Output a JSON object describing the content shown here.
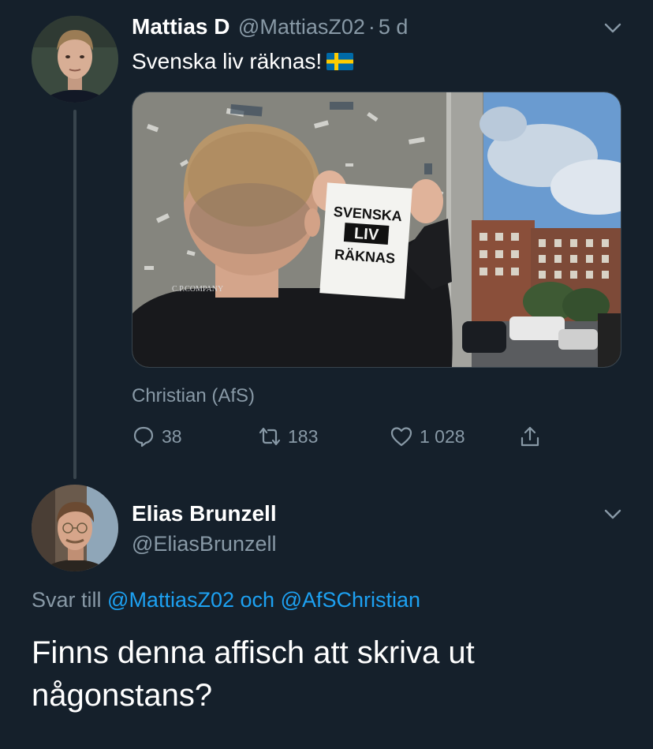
{
  "tweet1": {
    "display_name": "Mattias D",
    "handle": "@MattiasZ02",
    "separator": "·",
    "time": "5 d",
    "text": "Svenska liv räknas!",
    "flag_emoji": "🇸🇪",
    "media_poster_text": [
      "SVENSKA",
      "LIV",
      "RÄKNAS"
    ],
    "media_jacket_text": "C.P.COMPANY",
    "tag": "Christian (AfS)",
    "replies": "38",
    "retweets": "183",
    "likes": "1 028"
  },
  "tweet2": {
    "display_name": "Elias Brunzell",
    "handle": "@EliasBrunzell",
    "reply_prefix": "Svar till",
    "reply_to_1": "@MattiasZ02",
    "reply_join": "och",
    "reply_to_2": "@AfSChristian",
    "text_line1": "Finns denna affisch att skriva ut",
    "text_line2": "någonstans?"
  },
  "icons": {
    "menu": "chevron-down-icon",
    "reply": "reply-icon",
    "retweet": "retweet-icon",
    "like": "heart-icon",
    "share": "share-icon"
  },
  "colors": {
    "background": "#15202b",
    "muted": "#8899a6",
    "link": "#1da1f2",
    "divider": "#38444d",
    "flag_blue": "#006aa7",
    "flag_yellow": "#fecc00"
  }
}
